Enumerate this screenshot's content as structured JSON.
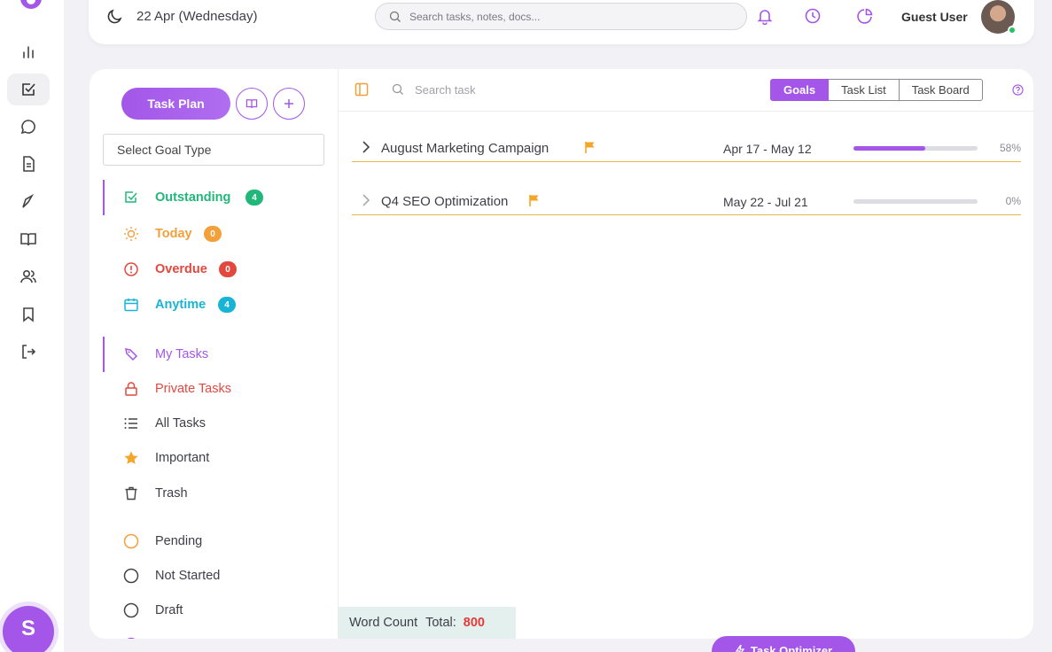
{
  "header": {
    "date": "22 Apr (Wednesday)",
    "search_placeholder": "Search tasks, notes, docs...",
    "user_name": "Guest User"
  },
  "rail": {
    "items": [
      "chart-icon",
      "task-icon",
      "chat-icon",
      "document-icon",
      "pen-icon",
      "book-icon",
      "users-icon",
      "bookmark-icon",
      "logout-icon"
    ],
    "fab_label": "S"
  },
  "sidebar": {
    "task_plan_label": "Task Plan",
    "goal_select_placeholder": "Select Goal Type",
    "filters": [
      {
        "label": "Outstanding",
        "count": "4",
        "color": "#21b77a"
      },
      {
        "label": "Today",
        "count": "0",
        "color": "#f3a03b"
      },
      {
        "label": "Overdue",
        "count": "0",
        "color": "#e2483d"
      },
      {
        "label": "Anytime",
        "count": "4",
        "color": "#19b3d6"
      }
    ],
    "lists": [
      {
        "label": "My Tasks",
        "color": "#a356e8"
      },
      {
        "label": "Private Tasks",
        "color": "#e2483d"
      },
      {
        "label": "All Tasks",
        "color": "#3e3e48"
      },
      {
        "label": "Important",
        "color": "#3e3e48"
      },
      {
        "label": "Trash",
        "color": "#3e3e48"
      }
    ],
    "statuses": [
      {
        "label": "Pending"
      },
      {
        "label": "Not Started"
      },
      {
        "label": "Draft"
      }
    ]
  },
  "toolbar": {
    "search_placeholder": "Search task",
    "views": [
      "Goals",
      "Task List",
      "Task Board"
    ],
    "active_view": "Goals"
  },
  "goals": [
    {
      "name": "August Marketing Campaign",
      "dates": "Apr 17 - May 12",
      "progress": 58,
      "progress_label": "58%"
    },
    {
      "name": "Q4 SEO Optimization",
      "dates": "May 22 - Jul 21",
      "progress": 0,
      "progress_label": "0%"
    }
  ],
  "word_count": {
    "label": "Word Count",
    "total_label": "Total:",
    "value": "800"
  },
  "optimizer_label": "Task Optimizer",
  "colors": {
    "accent": "#a356e8",
    "goal_underline": "#e8b64a",
    "flag": "#f3a62a"
  }
}
